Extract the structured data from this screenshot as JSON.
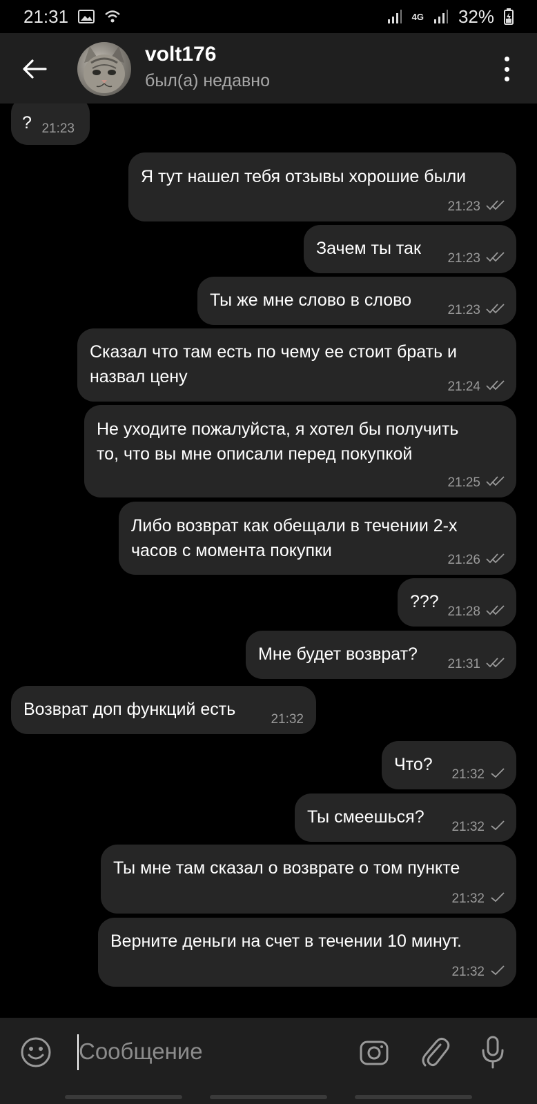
{
  "status_bar": {
    "time": "21:31",
    "network": "4G",
    "battery": "32%"
  },
  "header": {
    "name": "volt176",
    "status": "был(а) недавно"
  },
  "messages": [
    {
      "side": "in",
      "text": "?",
      "time": "21:23"
    },
    {
      "side": "out",
      "text": "Я тут нашел тебя отзывы хорошие были",
      "time": "21:23",
      "ticks": "double"
    },
    {
      "side": "out",
      "text": "Зачем ты так",
      "time": "21:23",
      "ticks": "double"
    },
    {
      "side": "out",
      "text": "Ты же мне слово в слово",
      "time": "21:23",
      "ticks": "double"
    },
    {
      "side": "out",
      "text": "Сказал что там есть по чему ее стоит брать и назвал цену",
      "line1": "Сказал что там есть по чему ее стоит брать и",
      "line2": "назвал цену",
      "time": "21:24",
      "ticks": "double"
    },
    {
      "side": "out",
      "text": "Не уходите пожалуйста, я хотел бы получить то, что вы мне описали перед покупкой",
      "line1": "Не уходите пожалуйста, я хотел бы получить",
      "line2": "то, что вы мне описали перед покупкой",
      "time": "21:25",
      "ticks": "double"
    },
    {
      "side": "out",
      "text": "Либо возврат как обещали в течении 2-х часов с момента покупки",
      "line1": "Либо возврат как обещали в течении 2-х",
      "line2": "часов с момента покупки",
      "time": "21:26",
      "ticks": "double"
    },
    {
      "side": "out",
      "text": "???",
      "time": "21:28",
      "ticks": "double"
    },
    {
      "side": "out",
      "text": "Мне будет возврат?",
      "time": "21:31",
      "ticks": "double"
    },
    {
      "side": "in",
      "text": "Возврат доп функций есть",
      "time": "21:32"
    },
    {
      "side": "out",
      "text": "Что?",
      "time": "21:32",
      "ticks": "single"
    },
    {
      "side": "out",
      "text": "Ты смеешься?",
      "time": "21:32",
      "ticks": "single"
    },
    {
      "side": "out",
      "text": "Ты мне там сказал о возврате о том пункте",
      "time": "21:32",
      "ticks": "single"
    },
    {
      "side": "out",
      "text": "Верните деньги на счет в течении 10 минут.",
      "time": "21:32",
      "ticks": "single"
    }
  ],
  "input": {
    "placeholder": "Сообщение"
  }
}
